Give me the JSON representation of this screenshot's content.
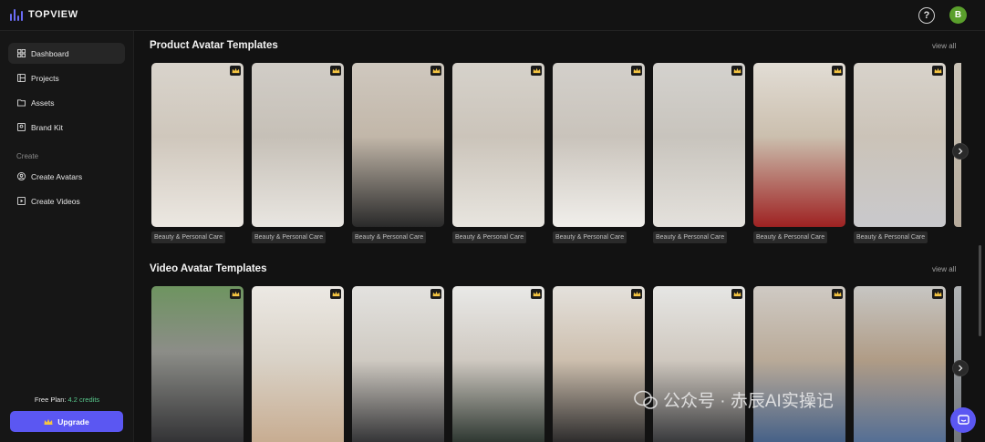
{
  "app": {
    "name": "TOPVIEW",
    "user_initial": "B",
    "help_label": "?"
  },
  "colors": {
    "accent": "#5b57f2",
    "credits": "#58c88c",
    "background": "#121212"
  },
  "sidebar": {
    "items": [
      {
        "label": "Dashboard",
        "icon": "dashboard-icon"
      },
      {
        "label": "Projects",
        "icon": "projects-icon"
      },
      {
        "label": "Assets",
        "icon": "folder-icon"
      },
      {
        "label": "Brand Kit",
        "icon": "brand-kit-icon"
      }
    ],
    "section_label": "Create",
    "create_items": [
      {
        "label": "Create Avatars",
        "icon": "create-avatar-icon"
      },
      {
        "label": "Create Videos",
        "icon": "create-video-icon"
      }
    ],
    "plan_label": "Free Plan:",
    "plan_credits": "4.2 credits",
    "upgrade_label": "Upgrade"
  },
  "product_section": {
    "title": "Product Avatar Templates",
    "view_all": "view all",
    "cards": [
      {
        "tag": "Beauty & Personal Care"
      },
      {
        "tag": "Beauty & Personal Care"
      },
      {
        "tag": "Beauty & Personal Care"
      },
      {
        "tag": "Beauty & Personal Care"
      },
      {
        "tag": "Beauty & Personal Care"
      },
      {
        "tag": "Beauty & Personal Care"
      },
      {
        "tag": "Beauty & Personal Care"
      },
      {
        "tag": "Beauty & Personal Care"
      }
    ]
  },
  "video_section": {
    "title": "Video Avatar Templates",
    "view_all": "view all"
  },
  "watermark": {
    "text": "公众号 · 赤辰AI实操记"
  }
}
